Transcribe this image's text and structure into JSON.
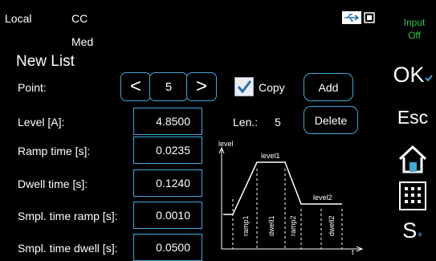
{
  "status": {
    "local": "Local",
    "cc": "CC",
    "med": "Med",
    "input": "Input",
    "input_state": "Off"
  },
  "panel": {
    "title": "New List",
    "point_label": "Point:",
    "point_value": "5",
    "prev_glyph": "<",
    "next_glyph": ">",
    "copy_label": "Copy",
    "copy_checked": true,
    "add_label": "Add",
    "delete_label": "Delete",
    "len_label": "Len.:",
    "len_value": "5",
    "rows": [
      {
        "label": "Level [A]:",
        "value": "4.8500"
      },
      {
        "label": "Ramp time [s]:",
        "value": "0.0235"
      },
      {
        "label": "Dwell time [s]:",
        "value": "0.1240"
      },
      {
        "label": "Smpl. time ramp [s]:",
        "value": "0.0010"
      },
      {
        "label": "Smpl. time dwell [s]:",
        "value": "0.0500"
      }
    ]
  },
  "diagram": {
    "y_axis": "level",
    "x_axis": "t",
    "level1": "level1",
    "level2": "level2",
    "segments": [
      "ramp1",
      "dwell1",
      "ramp2",
      "dwell2"
    ]
  },
  "softkeys": {
    "ok": "OK",
    "esc": "Esc",
    "s": "S",
    "s_sub": "+"
  },
  "colors": {
    "accent_blue": "#3fa8d8",
    "input_green": "#2fc94b",
    "background": "#000000",
    "text": "#ffffff"
  }
}
